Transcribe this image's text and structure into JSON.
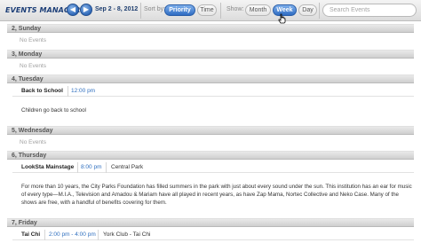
{
  "toolbar": {
    "title": "EVENTS MANAGER",
    "prev_label": "◀",
    "next_label": "▶",
    "date_range": "Sep 2 - 8, 2012",
    "sort_label": "Sort by:",
    "sort_options": [
      "Priority",
      "Time"
    ],
    "sort_selected": "Priority",
    "show_label": "Show:",
    "view_options": [
      "Month",
      "Week",
      "Day"
    ],
    "view_selected": "Week",
    "search_placeholder": "Search Events"
  },
  "days": [
    {
      "label": "2, Sunday",
      "empty_text": "No Events"
    },
    {
      "label": "3, Monday",
      "empty_text": "No Events"
    },
    {
      "label": "4, Tuesday",
      "event": {
        "name": "Back to School",
        "time": "12:00 pm",
        "location": "",
        "description": "Children go back to school"
      }
    },
    {
      "label": "5, Wednesday",
      "empty_text": "No Events"
    },
    {
      "label": "6, Thursday",
      "event": {
        "name": "LookSta Mainstage",
        "time": "8:00 pm",
        "location": "Central Park",
        "description": "For more than 10 years, the City Parks Foundation has filled summers in the park with just about every sound under the sun. This institution has an ear for music of every type—M.I.A., Television and Amadou & Mariam have all played in recent years, as have Zap Mama, Nortec Collective and Neko Case. Many of the shows are free, with a handful of benefits covering for them."
      }
    },
    {
      "label": "7, Friday",
      "event": {
        "name": "Tai Chi",
        "time": "2:00 pm - 4:00 pm",
        "location": "York Club - Tai Chi",
        "description": ""
      }
    }
  ],
  "colors": {
    "accent": "#2f6cc2",
    "time_text": "#2f6fbf",
    "title": "#1d3f78"
  }
}
